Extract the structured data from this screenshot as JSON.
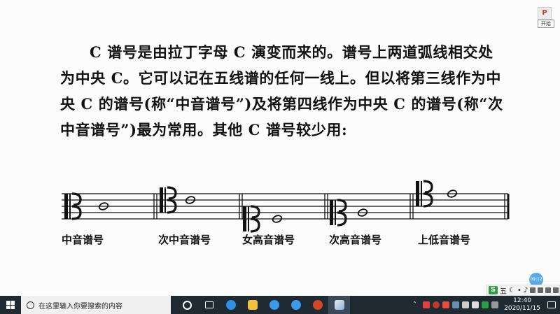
{
  "paragraph": [
    "C 谱号是由拉丁字母 C 演变而来的。谱号上两道弧线相交处",
    "为中央 C。它可以记在五线谱的任何一线上。但以将第三线作为中",
    "央 C 的谱号(称“中音谱号”)及将第四线作为中央 C 的谱号(称“次",
    "中音谱号”)最为常用。其他 C 谱号较少用:"
  ],
  "clefs": [
    {
      "label": "中音谱号",
      "staff_line": 3
    },
    {
      "label": "次中音谱号",
      "staff_line": 4
    },
    {
      "label": "女高音谱号",
      "staff_line": 1
    },
    {
      "label": "次高音谱号",
      "staff_line": 2
    },
    {
      "label": "上低音谱号",
      "staff_line": 5
    }
  ],
  "clef_symbol": "C-clef",
  "overlay": {
    "corner_p": "P",
    "corner_button": "开始",
    "float_ball": "09:12"
  },
  "ime": {
    "logo": "S",
    "mode": "五",
    "icons": [
      "moon-icon",
      "dot-icon",
      "mic-icon",
      "keyboard-icon",
      "grid-icon",
      "toolbox-icon",
      "shirt-icon"
    ]
  },
  "taskbar": {
    "search_placeholder": "在这里输入你要搜索的内容",
    "apps": [
      "cortana-icon",
      "task-view-icon",
      "edge-icon",
      "file-explorer-icon",
      "ie-icon",
      "ie-icon",
      "powerpoint-icon",
      "photo-app-icon"
    ],
    "clock_time": "12:40",
    "clock_date": "2020/11/15",
    "colors": {
      "bar": "#1f2a33",
      "search": "#f0f0f0"
    }
  }
}
